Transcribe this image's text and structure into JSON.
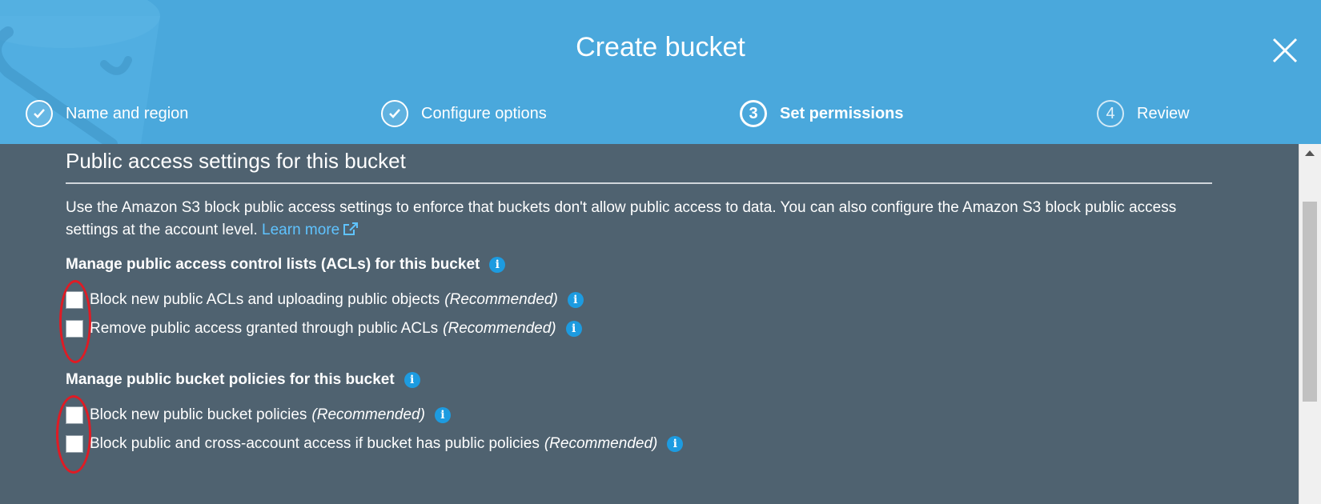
{
  "header": {
    "title": "Create bucket",
    "close_icon": "close-icon",
    "steps": [
      {
        "number": "1",
        "label": "Name and region",
        "state": "done",
        "icon": "checkmark-icon"
      },
      {
        "number": "2",
        "label": "Configure options",
        "state": "done",
        "icon": "checkmark-icon"
      },
      {
        "number": "3",
        "label": "Set permissions",
        "state": "current"
      },
      {
        "number": "4",
        "label": "Review",
        "state": "future"
      }
    ]
  },
  "body": {
    "section_title": "Public access settings for this bucket",
    "intro_text": "Use the Amazon S3 block public access settings to enforce that buckets don't allow public access to data. You can also configure the Amazon S3 block public access settings at the account level.",
    "learn_more_label": "Learn more",
    "groups": [
      {
        "heading": "Manage public access control lists (ACLs) for this bucket",
        "options": [
          {
            "label": "Block new public ACLs and uploading public objects",
            "suffix": "(Recommended)",
            "checked": false
          },
          {
            "label": "Remove public access granted through public ACLs",
            "suffix": "(Recommended)",
            "checked": false
          }
        ]
      },
      {
        "heading": "Manage public bucket policies for this bucket",
        "options": [
          {
            "label": "Block new public bucket policies",
            "suffix": "(Recommended)",
            "checked": false
          },
          {
            "label": "Block public and cross-account access if bucket has public policies",
            "suffix": "(Recommended)",
            "checked": false
          }
        ]
      }
    ]
  },
  "colors": {
    "header_bg": "#4aa8dc",
    "body_bg": "#4f6270",
    "link": "#5fc3ff",
    "info_icon": "#1d9be0",
    "annotation_red": "#e01b24"
  }
}
